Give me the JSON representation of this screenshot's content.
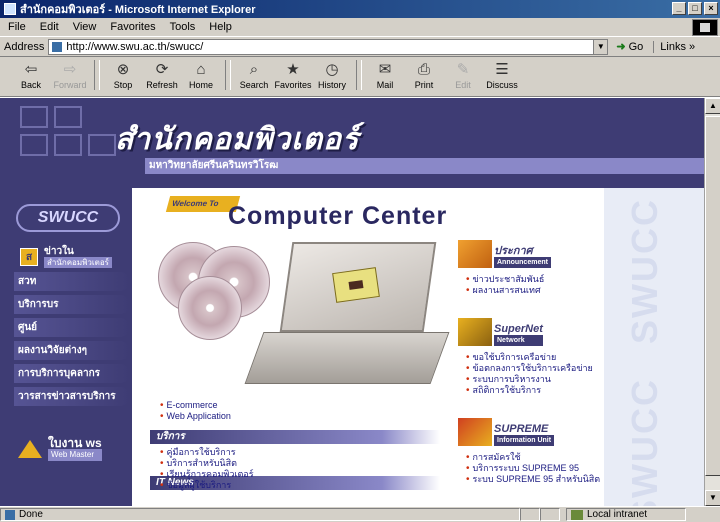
{
  "window": {
    "title": "สำนักคอมพิวเตอร์ - Microsoft Internet Explorer",
    "controls": [
      "_",
      "□",
      "×"
    ]
  },
  "menu": [
    "File",
    "Edit",
    "View",
    "Favorites",
    "Tools",
    "Help"
  ],
  "address": {
    "label": "Address",
    "url": "http://www.swu.ac.th/swucc/",
    "go_label": "Go",
    "links_label": "Links »"
  },
  "toolbar": [
    {
      "label": "Back",
      "icon": "back-arrow-icon",
      "glyph": "⇦",
      "enabled": true
    },
    {
      "label": "Forward",
      "icon": "forward-arrow-icon",
      "glyph": "⇨",
      "enabled": false
    },
    {
      "label": "Stop",
      "icon": "stop-icon",
      "glyph": "⊗",
      "enabled": true
    },
    {
      "label": "Refresh",
      "icon": "refresh-icon",
      "glyph": "⟳",
      "enabled": true
    },
    {
      "label": "Home",
      "icon": "home-icon",
      "glyph": "⌂",
      "enabled": true
    },
    {
      "label": "Search",
      "icon": "search-icon",
      "glyph": "⌕",
      "enabled": true
    },
    {
      "label": "Favorites",
      "icon": "favorites-icon",
      "glyph": "★",
      "enabled": true
    },
    {
      "label": "History",
      "icon": "history-icon",
      "glyph": "◷",
      "enabled": true
    },
    {
      "label": "Mail",
      "icon": "mail-icon",
      "glyph": "✉",
      "enabled": true
    },
    {
      "label": "Print",
      "icon": "print-icon",
      "glyph": "⎙",
      "enabled": true
    },
    {
      "label": "Edit",
      "icon": "edit-icon",
      "glyph": "✎",
      "enabled": false
    },
    {
      "label": "Discuss",
      "icon": "discuss-icon",
      "glyph": "☰",
      "enabled": true
    }
  ],
  "page": {
    "header_title": "สำนักคอมพิวเตอร์",
    "header_subtitle": "มหาวิทยาลัยศรีนครินทรวิโรฒ",
    "logo_text": "SWUCC",
    "news_button": {
      "icon_text": "ส",
      "label": "ข่าวใน",
      "sub": "สำนักคอมพิวเตอร์"
    },
    "nav_items": [
      "สวท",
      "บริการบร",
      "ศูนย์",
      "ผลงานวิจัยต่างๆ",
      "การบริการบุคลากร",
      "วารสารข่าวสารบริการ"
    ],
    "bottom_logo": {
      "label": "ใบงาน ws",
      "sub": "Web Master"
    },
    "watermark": "SWUCC",
    "welcome_tag": "Welcome To",
    "center_title": "Computer Center",
    "it_news": {
      "title": "IT News",
      "links": [
        "E-commerce",
        "Web Application"
      ]
    },
    "services": {
      "title": "บริการ",
      "links": [
        "คู่มือการใช้บริการ",
        "บริการสำหรับนิสิต",
        "เรียนรู้การคอมพิวเตอร์",
        "ข้อมูลผู้ใช้บริการ"
      ]
    },
    "right_boxes": [
      {
        "title": "ประกาศ",
        "sub": "Announcement",
        "icon": "folder-icon",
        "links": [
          "ข่าวประชาสัมพันธ์",
          "ผลงานสารสนเทศ"
        ]
      },
      {
        "title": "SuperNet",
        "sub": "Network",
        "icon": "network-icon",
        "links": [
          "ขอใช้บริการเครือข่าย",
          "ข้อตกลงการใช้บริการเครือข่าย",
          "ระบบการบริหารงาน",
          "สถิติการใช้บริการ"
        ]
      },
      {
        "title": "SUPREME",
        "sub": "Information Unit",
        "icon": "supreme-icon",
        "links": [
          "การสมัครใช้",
          "บริการระบบ SUPREME 95",
          "ระบบ SUPREME 95 สำหรับนิสิต"
        ]
      }
    ]
  },
  "status": {
    "text": "Done",
    "zone": "Local intranet"
  }
}
